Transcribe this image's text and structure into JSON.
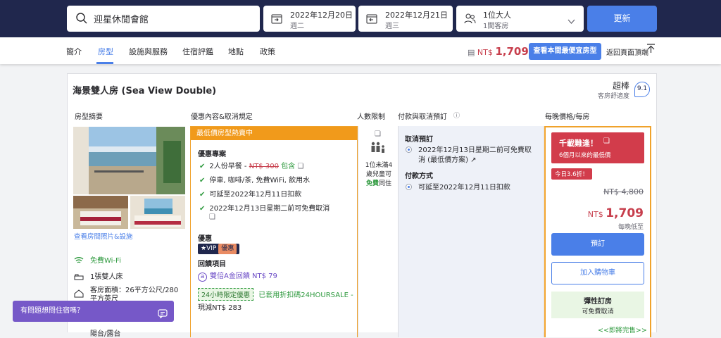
{
  "search": {
    "hotel": "迎星休閒會館"
  },
  "checkin": {
    "date": "2022年12月20日",
    "weekday": "週二"
  },
  "checkout": {
    "date": "2022年12月21日",
    "weekday": "週三"
  },
  "guests": {
    "line1": "1位大人",
    "line2": "1間客房"
  },
  "update_label": "更新",
  "nav": {
    "tabs": [
      "簡介",
      "房型",
      "設施與服務",
      "住宿評鑑",
      "地點",
      "政策"
    ],
    "price_prefix": "NT$",
    "price": "1,709",
    "cheapest_label": "查看本間最便宜房型",
    "back_top": "返回頁面頂端"
  },
  "room": {
    "title": "海景雙人房 (Sea View Double)",
    "rating_word": "超棒",
    "rating_sub": "客房舒適度",
    "score": "9.1",
    "col_headers": [
      "房型摘要",
      "優惠內容&取消規定",
      "人數限制",
      "付款與取消預訂",
      "每晚價格/每房"
    ],
    "view_photos": "查看房間照片&設施",
    "amenities": [
      "免費Wi-Fi",
      "1張雙人床",
      "客房面積：26平方公尺/280平方英尺",
      "陽台/露台"
    ]
  },
  "offer": {
    "header": "最低價房型熱賣中",
    "section1": "優惠專案",
    "items": [
      {
        "pre": "2人份早餐 - ",
        "strike": "NT$ 300",
        "post": " 包含"
      },
      {
        "pre": "停車, 咖啡/茶, 免費WiFi, 飲用水"
      },
      {
        "pre": "可延至2022年12月11日扣款"
      },
      {
        "pre": "2022年12月13日星期二前可免費取消"
      }
    ],
    "section2": "優惠",
    "vip": "VIP",
    "vip_tag": "優惠",
    "section3": "回饋項目",
    "reward": "雙倍A金回饋",
    "reward_amount": "NT$ 79",
    "limited": "24小時限定優惠",
    "limited_text": "已套用折扣碼24HOURSALE -",
    "limited_now": "現減NT$ 283"
  },
  "occupancy": {
    "line1": "1位未滿4",
    "line2": "歲兒童可",
    "free": "免費",
    "with": "同住"
  },
  "payment": {
    "cancel_title": "取消預訂",
    "cancel_line1": "2022年12月13日星期二前可免費取",
    "cancel_line2": "消 (最低價方案)",
    "method_title": "付款方式",
    "method_line": "可延至2022年12月11日扣款"
  },
  "price": {
    "deal_title": "千載難逢！",
    "deal_sub": "6個月以來的最低價",
    "today": "今日3.6折！",
    "original": "NT$ 4,800",
    "currency": "NT$",
    "now": "1,709",
    "nightly": "每晚低至",
    "book": "預訂",
    "cart": "加入購物車",
    "flex_title": "彈性訂房",
    "flex_sub": "可免費取消",
    "more": "<<即將完售>>"
  },
  "chat": "有問題想問住宿嗎？",
  "colors": {
    "navy": "#20274d",
    "blue": "#4a7fe8",
    "orange": "#f19a1b",
    "red": "#d23c4b",
    "green": "#2f9a3f"
  }
}
